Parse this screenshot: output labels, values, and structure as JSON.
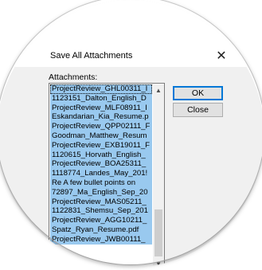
{
  "dialog": {
    "title": "Save All Attachments",
    "close_glyph": "✕",
    "attachments_label": "Attachments:",
    "ok_label": "OK",
    "close_label": "Close"
  },
  "attachments": [
    "ProjectReview_GHL00311_I",
    "1123151_Dalton_English_D",
    "ProjectReview_MLF08911_I",
    "Eskandarian_Kia_Resume.p",
    "ProjectReview_QPP02111_F",
    "Goodman_Matthew_Resum",
    "ProjectReview_EXB19011_F",
    "1120615_Horvath_English_",
    "ProjectReview_BOA25311_",
    "1118774_Landes_May_201!",
    "Re A few bullet points on",
    "72897_Ma_English_Sep_20",
    "ProjectReview_MAS05211_",
    "1122831_Shemsu_Sep_201",
    "ProjectReview_AGG10211_",
    "Spatz_Ryan_Resume.pdf",
    "ProjectReview_JWB00111_"
  ],
  "icons": {
    "scroll_up": "▲",
    "scroll_down": "▼"
  }
}
